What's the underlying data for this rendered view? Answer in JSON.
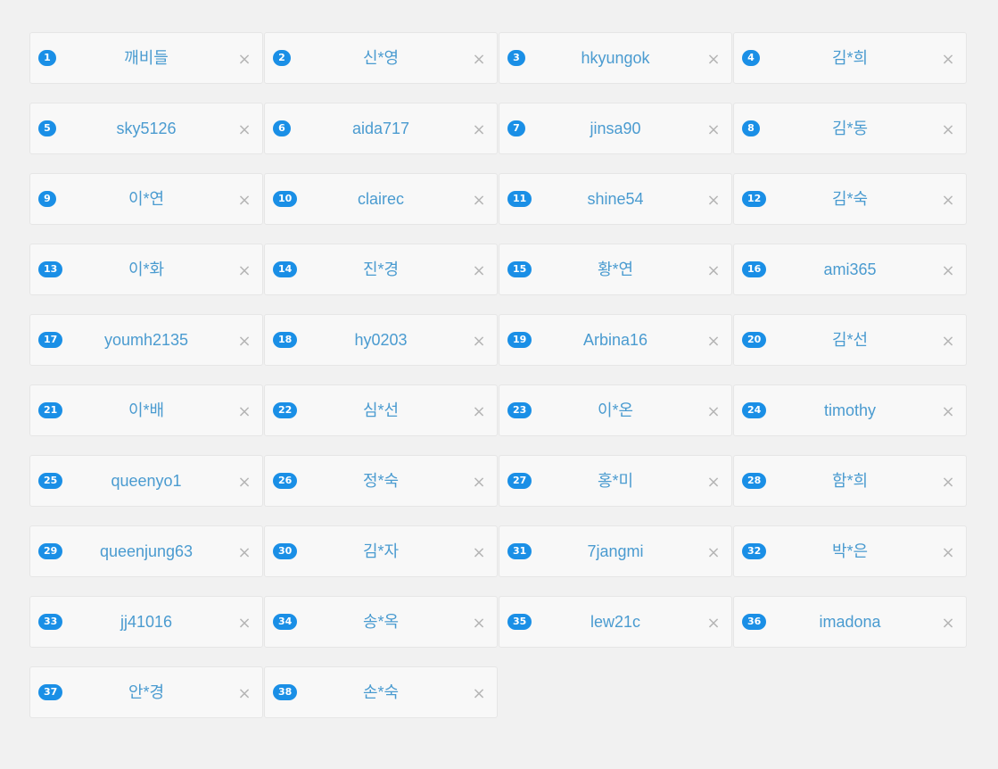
{
  "close_glyph": "×",
  "accent_color": "#1a8fe6",
  "name_color": "#4a9bd0",
  "items": [
    {
      "num": "1",
      "name": "깨비들"
    },
    {
      "num": "2",
      "name": "신*영"
    },
    {
      "num": "3",
      "name": "hkyungok"
    },
    {
      "num": "4",
      "name": "김*희"
    },
    {
      "num": "5",
      "name": "sky5126"
    },
    {
      "num": "6",
      "name": "aida717"
    },
    {
      "num": "7",
      "name": "jinsa90"
    },
    {
      "num": "8",
      "name": "김*동"
    },
    {
      "num": "9",
      "name": "이*연"
    },
    {
      "num": "10",
      "name": "clairec"
    },
    {
      "num": "11",
      "name": "shine54"
    },
    {
      "num": "12",
      "name": "김*숙"
    },
    {
      "num": "13",
      "name": "이*화"
    },
    {
      "num": "14",
      "name": "진*경"
    },
    {
      "num": "15",
      "name": "황*연"
    },
    {
      "num": "16",
      "name": "ami365"
    },
    {
      "num": "17",
      "name": "youmh2135"
    },
    {
      "num": "18",
      "name": "hy0203"
    },
    {
      "num": "19",
      "name": "Arbina16"
    },
    {
      "num": "20",
      "name": "김*선"
    },
    {
      "num": "21",
      "name": "이*배"
    },
    {
      "num": "22",
      "name": "심*선"
    },
    {
      "num": "23",
      "name": "이*온"
    },
    {
      "num": "24",
      "name": "timothy"
    },
    {
      "num": "25",
      "name": "queenyo1"
    },
    {
      "num": "26",
      "name": "정*숙"
    },
    {
      "num": "27",
      "name": "홍*미"
    },
    {
      "num": "28",
      "name": "함*희"
    },
    {
      "num": "29",
      "name": "queenjung63"
    },
    {
      "num": "30",
      "name": "김*자"
    },
    {
      "num": "31",
      "name": "7jangmi"
    },
    {
      "num": "32",
      "name": "박*은"
    },
    {
      "num": "33",
      "name": "jj41016"
    },
    {
      "num": "34",
      "name": "송*옥"
    },
    {
      "num": "35",
      "name": "lew21c"
    },
    {
      "num": "36",
      "name": "imadona"
    },
    {
      "num": "37",
      "name": "안*경"
    },
    {
      "num": "38",
      "name": "손*숙"
    }
  ]
}
